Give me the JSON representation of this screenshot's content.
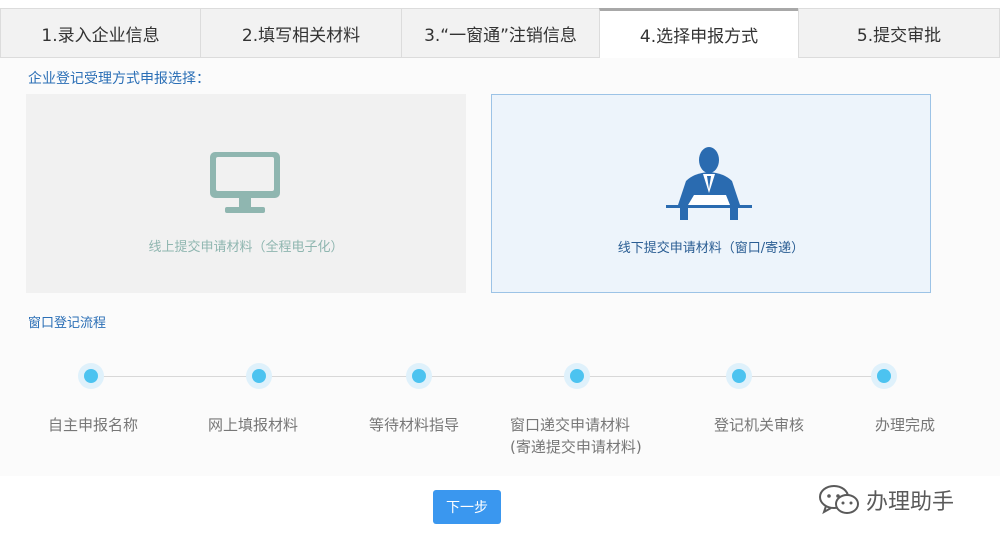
{
  "tabs": [
    {
      "label": "1.录入企业信息"
    },
    {
      "label": "2.填写相关材料"
    },
    {
      "label": "3.“一窗通”注销信息"
    },
    {
      "label": "4.选择申报方式"
    },
    {
      "label": "5.提交审批"
    }
  ],
  "active_tab_index": 3,
  "section_title": "企业登记受理方式申报选择：",
  "options": {
    "online": {
      "label": "线上提交申请材料（全程电子化）",
      "icon": "monitor-icon"
    },
    "offline": {
      "label": "线下提交申请材料（窗口/寄递）",
      "icon": "clerk-at-desk-icon"
    }
  },
  "flow": {
    "title": "窗口登记流程",
    "steps": [
      {
        "line1": "自主申报名称",
        "line2": ""
      },
      {
        "line1": "网上填报材料",
        "line2": ""
      },
      {
        "line1": "等待材料指导",
        "line2": ""
      },
      {
        "line1": "窗口递交申请材料",
        "line2": "(寄递提交申请材料)"
      },
      {
        "line1": "登记机关审核",
        "line2": ""
      },
      {
        "line1": "办理完成",
        "line2": ""
      }
    ]
  },
  "next_button": "下一步",
  "watermark": {
    "text": "办理助手",
    "icon": "wechat-icon"
  },
  "colors": {
    "accent": "#3a97ef",
    "link_blue": "#2b6fb6",
    "dot": "#4cc3f0",
    "online_icon": "#8fb6b0",
    "offline_icon": "#2a6bb0"
  }
}
